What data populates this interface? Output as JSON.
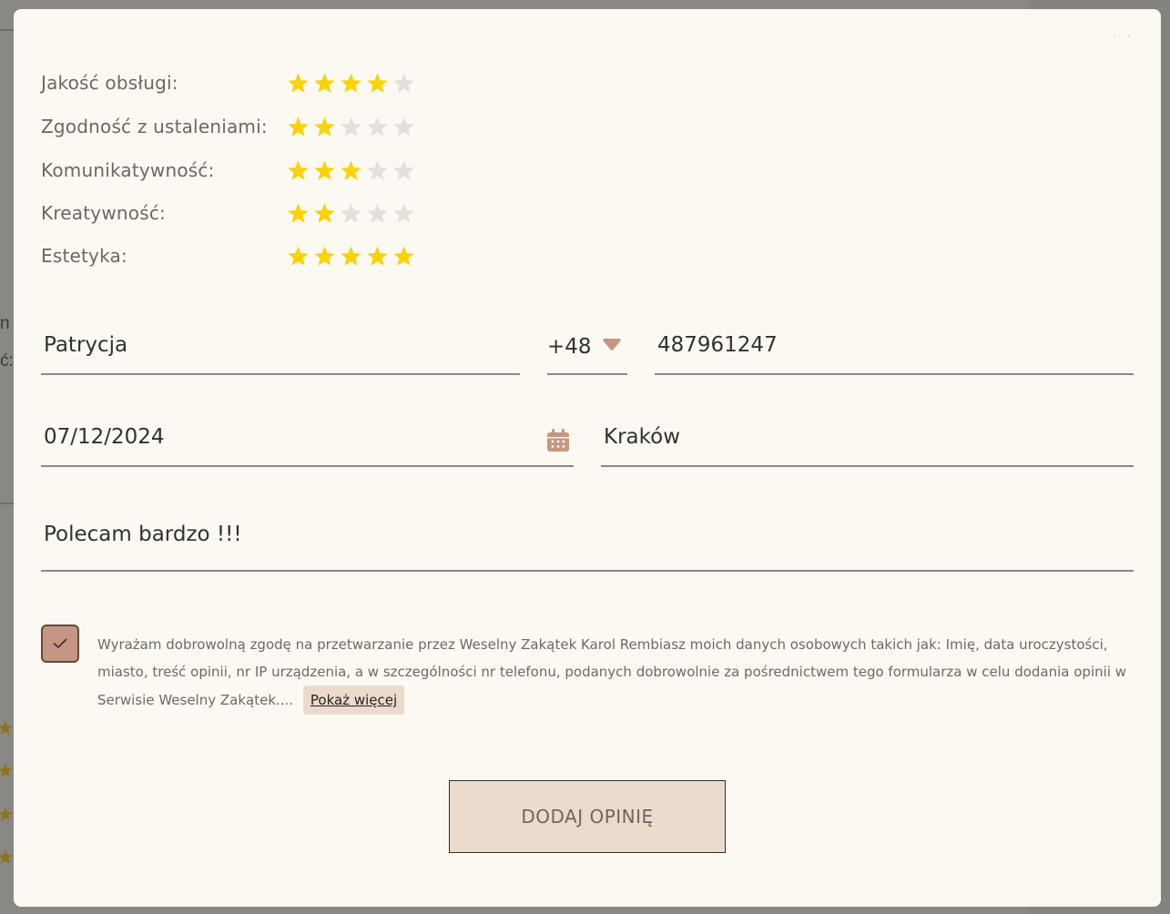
{
  "ratings": [
    {
      "label": "Jakość obsługi:",
      "stars": 4,
      "max": 5
    },
    {
      "label": "Zgodność z ustaleniami:",
      "stars": 2,
      "max": 5
    },
    {
      "label": "Komunikatywność:",
      "stars": 3,
      "max": 5
    },
    {
      "label": "Kreatywność:",
      "stars": 2,
      "max": 5
    },
    {
      "label": "Estetyka:",
      "stars": 5,
      "max": 5
    }
  ],
  "form": {
    "name_value": "Patrycja",
    "phone_prefix": "+48",
    "phone_value": "487961247",
    "date_value": "07/12/2024",
    "city_value": "Kraków",
    "opinion_value": "Polecam bardzo !!!"
  },
  "consent": {
    "text": "Wyrażam dobrowolną zgodę na przetwarzanie przez Weselny Zakątek Karol Rembiasz moich danych osobowych takich jak: Imię, data uroczystości, miasto, treść opinii, nr IP urządzenia, a w szczególności nr telefonu, podanych dobrowolnie za pośrednictwem tego formularza w celu dodania opinii w Serwisie Weselny Zakątek....",
    "show_more_label": "Pokaż więcej",
    "checked": true
  },
  "submit_label": "DODAJ OPINIĘ",
  "background": {
    "text_1": "n",
    "text_2": "ć:"
  },
  "colors": {
    "star_filled": "#f9d20a",
    "star_empty": "#e2e0dc",
    "accent": "#c59681",
    "button_bg": "#ebdbcc",
    "modal_bg": "#fcf9f2"
  },
  "icons": {
    "close": "close-icon",
    "caret": "chevron-down-icon",
    "calendar": "calendar-icon",
    "check": "check-icon",
    "star": "star-icon"
  }
}
